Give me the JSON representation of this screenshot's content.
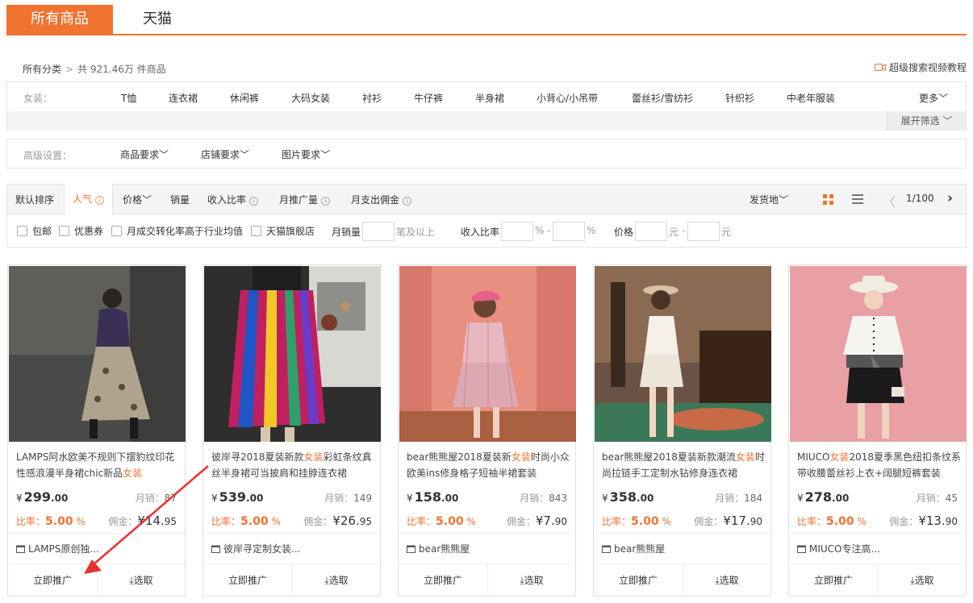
{
  "colors": {
    "accent": "#f07330",
    "border": "#e4e4e4",
    "muted": "#999999"
  },
  "top_tabs": [
    {
      "label": "所有商品",
      "active": true
    },
    {
      "label": "天猫",
      "active": false
    }
  ],
  "breadcrumb": {
    "root": "所有分类",
    "separator": ">",
    "count_text": "共 921.46万 件商品"
  },
  "tutorial": {
    "icon": "video-icon",
    "label": "超级搜索视频教程"
  },
  "category_filter": {
    "label": "女装：",
    "items": [
      "T恤",
      "连衣裙",
      "休闲裤",
      "大码女装",
      "衬衫",
      "牛仔裤",
      "半身裙",
      "小背心/小吊带",
      "蕾丝衫/雪纺衫",
      "针织衫",
      "中老年服装"
    ],
    "more": "更多",
    "expand": "展开筛选"
  },
  "advanced": {
    "label": "高级设置：",
    "items": [
      "商品要求",
      "店铺要求",
      "图片要求"
    ]
  },
  "sort_bar": {
    "items": [
      {
        "label": "默认排序",
        "info": false,
        "dropdown": false,
        "active": false
      },
      {
        "label": "人气",
        "info": true,
        "dropdown": false,
        "active": true
      },
      {
        "label": "价格",
        "info": false,
        "dropdown": true,
        "active": false
      },
      {
        "label": "销量",
        "info": false,
        "dropdown": false,
        "active": false
      },
      {
        "label": "收入比率",
        "info": true,
        "dropdown": false,
        "active": false
      },
      {
        "label": "月推广量",
        "info": true,
        "dropdown": false,
        "active": false
      },
      {
        "label": "月支出佣金",
        "info": true,
        "dropdown": false,
        "active": false
      }
    ],
    "ship_from": "发货地",
    "pagination": {
      "current": 1,
      "total": 100,
      "text": "1/100"
    }
  },
  "filters": {
    "checkboxes": [
      "包邮",
      "优惠券",
      "月成交转化率高于行业均值",
      "天猫旗舰店"
    ],
    "monthly_sales_label": "月销量",
    "monthly_sales_suffix": "笔及以上",
    "income_ratio_label": "收入比率",
    "percent": "%",
    "dash": "-",
    "price_label": "价格",
    "yuan": "元"
  },
  "products": [
    {
      "title_pre": "LAMPS阿水欧美不规则下摆豹纹印花性感浪漫半身裙chic新品",
      "title_hl": "女装",
      "title_post": "",
      "price_int": "299",
      "price_dec": ".00",
      "sales_label": "月销：",
      "sales": "87",
      "rate_label": "比率：",
      "rate": "5.00",
      "rate_unit": "%",
      "comm_label": "佣金：",
      "comm_int": "¥14.",
      "comm_dec": "95",
      "shop": "LAMPS原创独...",
      "promote": "立即推广",
      "select": "选取"
    },
    {
      "title_pre": "彼岸寻2018夏装新款",
      "title_hl": "女装",
      "title_post": "彩虹条纹真丝半身裙可当披肩和挂脖连衣裙",
      "price_int": "539",
      "price_dec": ".00",
      "sales_label": "月销：",
      "sales": "149",
      "rate_label": "比率：",
      "rate": "5.00",
      "rate_unit": "%",
      "comm_label": "佣金：",
      "comm_int": "¥26.",
      "comm_dec": "95",
      "shop": "彼岸寻定制女装...",
      "promote": "立即推广",
      "select": "选取"
    },
    {
      "title_pre": "bear熊熊屋2018夏装新",
      "title_hl": "女装",
      "title_post": "时尚小众欧美ins修身格子短袖半裙套装",
      "price_int": "158",
      "price_dec": ".00",
      "sales_label": "月销：",
      "sales": "843",
      "rate_label": "比率：",
      "rate": "5.00",
      "rate_unit": "%",
      "comm_label": "佣金：",
      "comm_int": "¥7.",
      "comm_dec": "90",
      "shop": "bear熊熊屋",
      "promote": "立即推广",
      "select": "选取"
    },
    {
      "title_pre": "bear熊熊屋2018夏装新款潮流",
      "title_hl": "女装",
      "title_post": "时尚拉链手工定制水钻修身连衣裙",
      "price_int": "358",
      "price_dec": ".00",
      "sales_label": "月销：",
      "sales": "184",
      "rate_label": "比率：",
      "rate": "5.00",
      "rate_unit": "%",
      "comm_label": "佣金：",
      "comm_int": "¥17.",
      "comm_dec": "90",
      "shop": "bear熊熊屋",
      "promote": "立即推广",
      "select": "选取"
    },
    {
      "title_pre": "MIUCO",
      "title_hl": "女装",
      "title_post": "2018夏季黑色纽扣条纹系带收腰蕾丝衫上衣+阔腿短裤套装",
      "price_int": "278",
      "price_dec": ".00",
      "sales_label": "月销：",
      "sales": "45",
      "rate_label": "比率：",
      "rate": "5.00",
      "rate_unit": "%",
      "comm_label": "佣金：",
      "comm_int": "¥13.",
      "comm_dec": "90",
      "shop": "MIUCO专注高...",
      "promote": "立即推广",
      "select": "选取"
    }
  ],
  "yen": "¥"
}
